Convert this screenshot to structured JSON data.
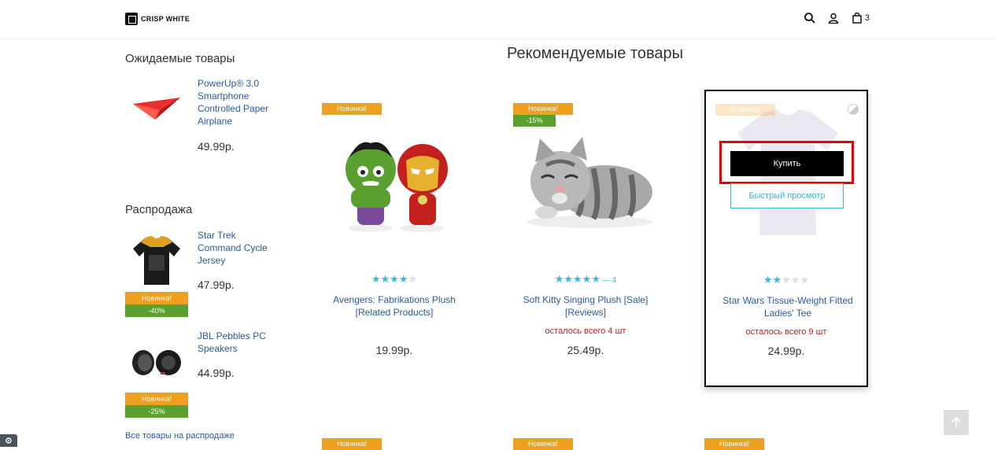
{
  "header": {
    "logo_text": "CRISP WHITE",
    "cart_count": "3"
  },
  "sidebar": {
    "awaited_title": "Ожидаемые товары",
    "awaited": [
      {
        "name": "PowerUp® 3.0 Smartphone Controlled Paper Airplane",
        "price": "49.99р."
      }
    ],
    "sale_title": "Распродажа",
    "sale": [
      {
        "name": "Star Trek Command Cycle Jersey",
        "price": "47.99р.",
        "badge_new": "Новинка!",
        "badge_sale": "-40%"
      },
      {
        "name": "JBL Pebbles PC Speakers",
        "price": "44.99р.",
        "badge_new": "Новинка!",
        "badge_sale": "-25%"
      }
    ],
    "all_sale_link": "Все товары на распродаже"
  },
  "main": {
    "title": "Рекомендуемые товары",
    "products": [
      {
        "badge_new": "Новинка!",
        "name": "Avengers: Fabrikations Plush [Related Products]",
        "price": "19.99р.",
        "rating": 4,
        "stock": ""
      },
      {
        "badge_new": "Новинка!",
        "badge_sale": "-15%",
        "name": "Soft Kitty Singing Plush [Sale] [Reviews]",
        "price": "25.49р.",
        "rating": 5,
        "review_count": "— 4",
        "stock": "осталось всего 4 шт"
      },
      {
        "badge_new": "Новинка!",
        "name": "Star Wars Tissue-Weight Fitted Ladies' Tee",
        "price": "24.99р.",
        "rating": 2,
        "stock": "осталось всего 9 шт",
        "buy_label": "Купить",
        "quick_view_label": "Быстрый просмотр"
      }
    ],
    "bottom_badge": "Новинка!"
  },
  "colors": {
    "accent": "#3ab8d8",
    "badge_new": "#f0a020",
    "badge_sale": "#5aa030",
    "link": "#2a5a9a",
    "stock": "#c02020",
    "highlight": "#e00000"
  }
}
